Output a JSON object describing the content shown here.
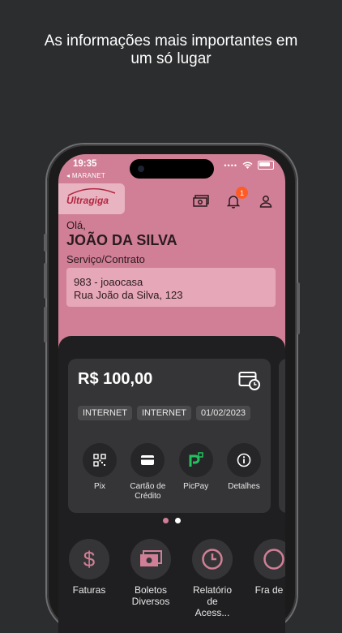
{
  "headline": [
    "As informações mais importantes em",
    "um só lugar"
  ],
  "status": {
    "time": "19:35",
    "carrier": "◂ MARANET"
  },
  "brand": {
    "logo": "Ultragiga",
    "accent": "#d07f96",
    "logo_color": "#b2263f"
  },
  "header": {
    "icons": [
      "money-icon",
      "bell-icon",
      "user-icon"
    ],
    "notification_count": "1"
  },
  "greeting": "Olá,",
  "user_name": "JOÃO DA SILVA",
  "service_label": "Serviço/Contrato",
  "contract": {
    "line1": "983 - joaocasa",
    "line2": "Rua João da Silva, 123"
  },
  "bill": {
    "amount": "R$ 100,00",
    "tags": [
      "INTERNET",
      "INTERNET",
      "01/02/2023"
    ],
    "actions": [
      {
        "label": "Pix",
        "icon": "qr-code-icon"
      },
      {
        "label": "Cartão de Crédito",
        "icon": "credit-card-icon"
      },
      {
        "label": "PicPay",
        "icon": "picpay-icon"
      },
      {
        "label": "Detalhes",
        "icon": "info-icon"
      }
    ]
  },
  "carousel": {
    "active_index": 1,
    "count": 2
  },
  "quick_actions": [
    {
      "label": "Faturas",
      "icon": "dollar-icon"
    },
    {
      "label": "Boletos Diversos",
      "icon": "bill-icon"
    },
    {
      "label": "Relatório de Acess...",
      "icon": "clock-icon"
    },
    {
      "label": "Fra de D",
      "icon": "partial-icon"
    }
  ]
}
